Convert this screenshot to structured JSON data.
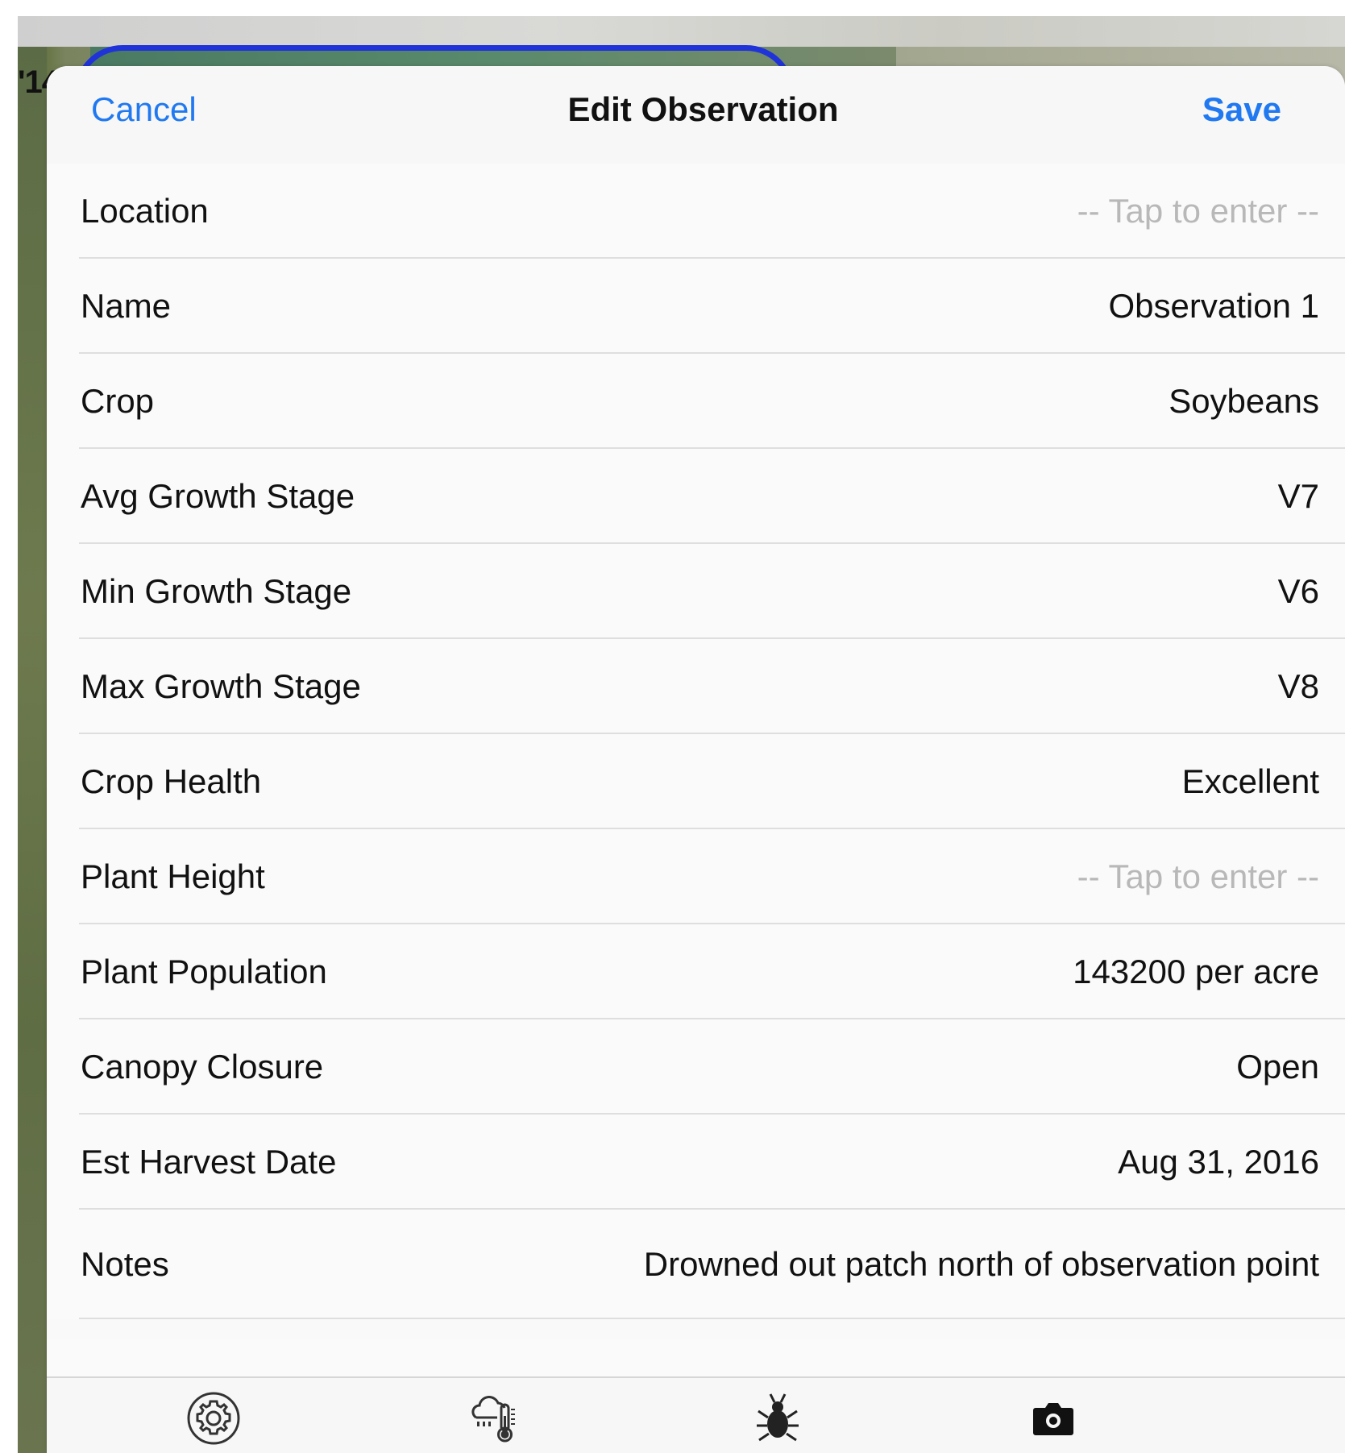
{
  "background": {
    "coordinate_fragment": "'14"
  },
  "navbar": {
    "cancel_label": "Cancel",
    "title": "Edit Observation",
    "save_label": "Save"
  },
  "rows": [
    {
      "label": "Location",
      "value": "-- Tap to enter --",
      "placeholder": true
    },
    {
      "label": "Name",
      "value": "Observation 1",
      "placeholder": false
    },
    {
      "label": "Crop",
      "value": "Soybeans",
      "placeholder": false
    },
    {
      "label": "Avg Growth Stage",
      "value": "V7",
      "placeholder": false
    },
    {
      "label": "Min Growth Stage",
      "value": "V6",
      "placeholder": false
    },
    {
      "label": "Max Growth Stage",
      "value": "V8",
      "placeholder": false
    },
    {
      "label": "Crop Health",
      "value": "Excellent",
      "placeholder": false
    },
    {
      "label": "Plant Height",
      "value": "-- Tap to enter --",
      "placeholder": true
    },
    {
      "label": "Plant Population",
      "value": "143200 per acre",
      "placeholder": false
    },
    {
      "label": "Canopy Closure",
      "value": "Open",
      "placeholder": false
    },
    {
      "label": "Est Harvest Date",
      "value": "Aug 31, 2016",
      "placeholder": false
    },
    {
      "label": "Notes",
      "value": "Drowned out patch north of observation point",
      "placeholder": false
    }
  ],
  "toolbar": {
    "icons": [
      "gear-icon",
      "weather-icon",
      "bug-icon",
      "camera-icon"
    ]
  },
  "colors": {
    "accent": "#2079f0",
    "placeholder": "#b8b8b8",
    "separator": "#dedede"
  }
}
